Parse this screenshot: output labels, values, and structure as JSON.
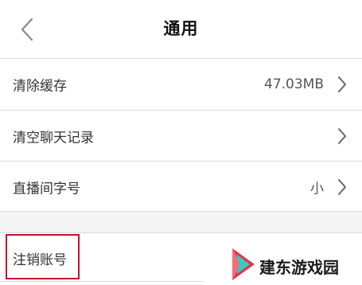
{
  "header": {
    "title": "通用",
    "back_icon": "chevron-left-icon"
  },
  "settings": {
    "items": [
      {
        "label": "清除缓存",
        "value": "47.03MB",
        "icon": "chevron-right-icon"
      },
      {
        "label": "清空聊天记录",
        "value": "",
        "icon": "chevron-right-icon"
      },
      {
        "label": "直播间字号",
        "value": "小",
        "icon": "chevron-right-icon"
      }
    ]
  },
  "account": {
    "cancel_label": "注销账号"
  },
  "watermark": {
    "text": "建东游戏园"
  },
  "colors": {
    "highlight_border": "#c8102e",
    "divider": "#dcdcdc",
    "section_gap": "#f4f4f4",
    "logo_red": "#e8334a",
    "logo_teal": "#2bd0c0"
  }
}
